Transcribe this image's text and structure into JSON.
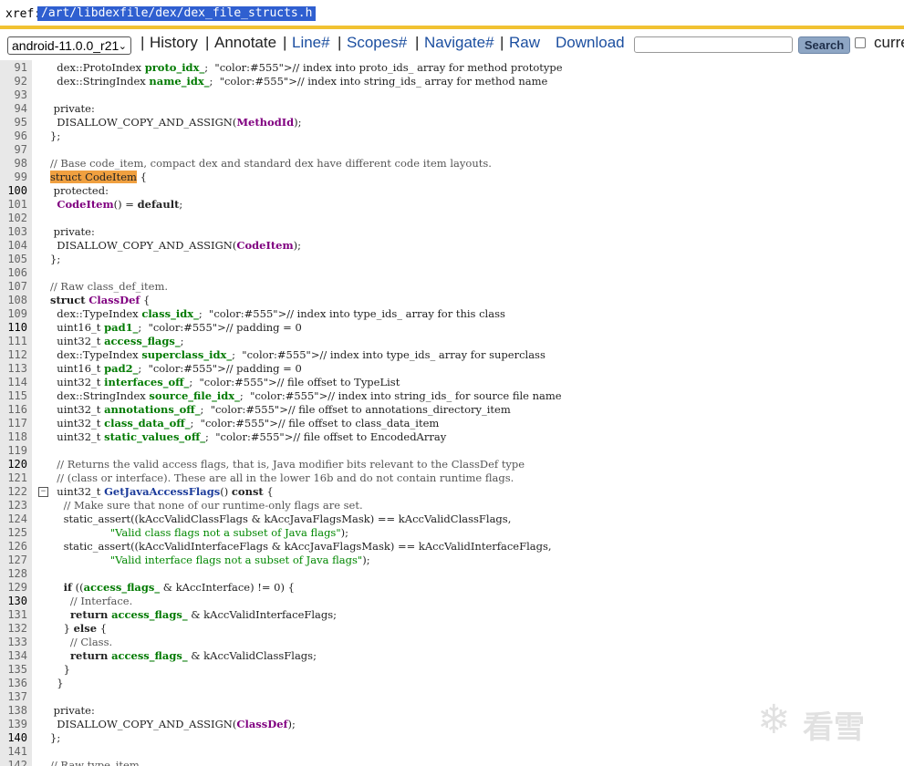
{
  "header": {
    "xref_label": "xref:",
    "path": "/art/libdexfile/dex/dex_file_structs.h"
  },
  "nav": {
    "branch": "android-11.0.0_r21",
    "items": [
      {
        "label": "History",
        "sep": "|"
      },
      {
        "label": "Annotate",
        "sep": "|"
      },
      {
        "label": "Line#",
        "sep": "|"
      },
      {
        "label": "Scopes#",
        "sep": "|"
      },
      {
        "label": "Navigate#",
        "sep": "|"
      },
      {
        "label": "Raw",
        "sep": "|"
      },
      {
        "label": "Download",
        "sep": ""
      }
    ],
    "search_placeholder": "",
    "search_button": "Search",
    "current_label": "current"
  },
  "code": {
    "lines": [
      {
        "n": "91",
        "t": "  dex::ProtoIndex proto_idx_;  // index into proto_ids_ array for method prototype"
      },
      {
        "n": "92",
        "t": "  dex::StringIndex name_idx_;  // index into string_ids_ array for method name"
      },
      {
        "n": "93",
        "t": ""
      },
      {
        "n": "94",
        "t": " private:"
      },
      {
        "n": "95",
        "t": "  DISALLOW_COPY_AND_ASSIGN(MethodId);"
      },
      {
        "n": "96",
        "t": "};"
      },
      {
        "n": "97",
        "t": ""
      },
      {
        "n": "98",
        "t": "// Base code_item, compact dex and standard dex have different code item layouts."
      },
      {
        "n": "99",
        "t": "struct CodeItem {"
      },
      {
        "n": "100",
        "t": " protected:"
      },
      {
        "n": "101",
        "t": "  CodeItem() = default;"
      },
      {
        "n": "102",
        "t": ""
      },
      {
        "n": "103",
        "t": " private:"
      },
      {
        "n": "104",
        "t": "  DISALLOW_COPY_AND_ASSIGN(CodeItem);"
      },
      {
        "n": "105",
        "t": "};"
      },
      {
        "n": "106",
        "t": ""
      },
      {
        "n": "107",
        "t": "// Raw class_def_item."
      },
      {
        "n": "108",
        "t": "struct ClassDef {"
      },
      {
        "n": "109",
        "t": "  dex::TypeIndex class_idx_;  // index into type_ids_ array for this class"
      },
      {
        "n": "110",
        "t": "  uint16_t pad1_;  // padding = 0"
      },
      {
        "n": "111",
        "t": "  uint32_t access_flags_;"
      },
      {
        "n": "112",
        "t": "  dex::TypeIndex superclass_idx_;  // index into type_ids_ array for superclass"
      },
      {
        "n": "113",
        "t": "  uint16_t pad2_;  // padding = 0"
      },
      {
        "n": "114",
        "t": "  uint32_t interfaces_off_;  // file offset to TypeList"
      },
      {
        "n": "115",
        "t": "  dex::StringIndex source_file_idx_;  // index into string_ids_ for source file name"
      },
      {
        "n": "116",
        "t": "  uint32_t annotations_off_;  // file offset to annotations_directory_item"
      },
      {
        "n": "117",
        "t": "  uint32_t class_data_off_;  // file offset to class_data_item"
      },
      {
        "n": "118",
        "t": "  uint32_t static_values_off_;  // file offset to EncodedArray"
      },
      {
        "n": "119",
        "t": ""
      },
      {
        "n": "120",
        "t": "  // Returns the valid access flags, that is, Java modifier bits relevant to the ClassDef type"
      },
      {
        "n": "121",
        "t": "  // (class or interface). These are all in the lower 16b and do not contain runtime flags."
      },
      {
        "n": "122",
        "t": "  uint32_t GetJavaAccessFlags() const {"
      },
      {
        "n": "123",
        "t": "    // Make sure that none of our runtime-only flags are set."
      },
      {
        "n": "124",
        "t": "    static_assert((kAccValidClassFlags & kAccJavaFlagsMask) == kAccValidClassFlags,"
      },
      {
        "n": "125",
        "t": "                  \"Valid class flags not a subset of Java flags\");"
      },
      {
        "n": "126",
        "t": "    static_assert((kAccValidInterfaceFlags & kAccJavaFlagsMask) == kAccValidInterfaceFlags,"
      },
      {
        "n": "127",
        "t": "                  \"Valid interface flags not a subset of Java flags\");"
      },
      {
        "n": "128",
        "t": ""
      },
      {
        "n": "129",
        "t": "    if ((access_flags_ & kAccInterface) != 0) {"
      },
      {
        "n": "130",
        "t": "      // Interface."
      },
      {
        "n": "131",
        "t": "      return access_flags_ & kAccValidInterfaceFlags;"
      },
      {
        "n": "132",
        "t": "    } else {"
      },
      {
        "n": "133",
        "t": "      // Class."
      },
      {
        "n": "134",
        "t": "      return access_flags_ & kAccValidClassFlags;"
      },
      {
        "n": "135",
        "t": "    }"
      },
      {
        "n": "136",
        "t": "  }"
      },
      {
        "n": "137",
        "t": ""
      },
      {
        "n": "138",
        "t": " private:"
      },
      {
        "n": "139",
        "t": "  DISALLOW_COPY_AND_ASSIGN(ClassDef);"
      },
      {
        "n": "140",
        "t": "};"
      },
      {
        "n": "141",
        "t": ""
      },
      {
        "n": "142",
        "t": "// Raw type_item."
      }
    ]
  },
  "watermark": {
    "text": "看雪"
  }
}
